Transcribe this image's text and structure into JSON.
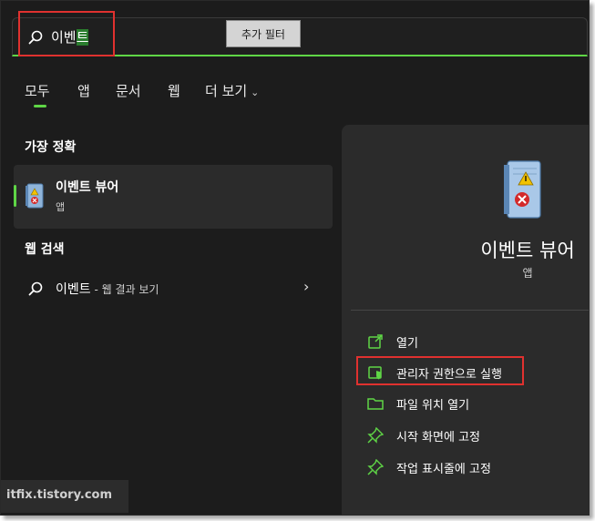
{
  "search": {
    "query_prefix": "이벤",
    "query_highlight": "트",
    "tooltip": "추가 필터"
  },
  "tabs": [
    {
      "label": "모두",
      "selected": true
    },
    {
      "label": "앱"
    },
    {
      "label": "문서"
    },
    {
      "label": "웹"
    },
    {
      "label": "더 보기"
    }
  ],
  "left": {
    "best_match_title": "가장 정확",
    "best_match": {
      "name": "이벤트 뷰어",
      "type": "앱",
      "icon": "event-viewer-icon"
    },
    "web_search_title": "웹 검색",
    "web_result": {
      "query": "이벤트",
      "rest": " - 웹 결과 보기"
    }
  },
  "right": {
    "app_name": "이벤트 뷰어",
    "app_type": "앱",
    "actions": [
      {
        "label": "열기",
        "icon": "open-external-icon"
      },
      {
        "label": "관리자 권한으로 실행",
        "icon": "shield-icon"
      },
      {
        "label": "파일 위치 열기",
        "icon": "folder-icon"
      },
      {
        "label": "시작 화면에 고정",
        "icon": "pin-icon"
      },
      {
        "label": "작업 표시줄에 고정",
        "icon": "pin-icon"
      }
    ]
  },
  "watermark": "itfix.tistory.com",
  "colors": {
    "accent": "#5fd646",
    "highlight_box": "#e0312f",
    "background": "#1c1c1c",
    "panel": "#2b2b2b"
  }
}
